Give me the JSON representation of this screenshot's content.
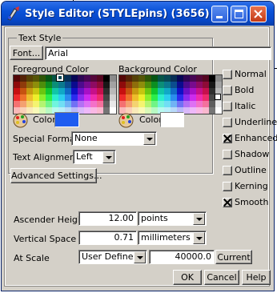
{
  "window": {
    "title": "Style Editor (STYLEpins) (3656)"
  },
  "text_style": {
    "group_label": "Text Style",
    "font_button": "Font...",
    "font_value": "Arial",
    "foreground_label": "Foreground Color",
    "background_label": "Background Color",
    "fg_color_label": "Color",
    "bg_color_label": "Color",
    "foreground_color": "#1e5cf0",
    "background_color": "#ffffff"
  },
  "special_format": {
    "label": "Special Format",
    "value": "None"
  },
  "text_alignment": {
    "label": "Text Alignment",
    "value": "Left"
  },
  "advanced_button": "Advanced Settings...",
  "styles": [
    {
      "label": "Normal",
      "checked": false
    },
    {
      "label": "Bold",
      "checked": false
    },
    {
      "label": "Italic",
      "checked": false
    },
    {
      "label": "Underline",
      "checked": false
    },
    {
      "label": "Enhanced",
      "checked": true
    },
    {
      "label": "Shadow",
      "checked": false
    },
    {
      "label": "Outline",
      "checked": false
    },
    {
      "label": "Kerning",
      "checked": false
    },
    {
      "label": "Smooth",
      "checked": true
    }
  ],
  "ascender": {
    "label": "Ascender Height",
    "value": "12.00",
    "unit": "points"
  },
  "vertical_space": {
    "label": "Vertical Space",
    "value": "0.71",
    "unit": "millimeters"
  },
  "at_scale": {
    "label": "At Scale",
    "mode": "User Defined",
    "value": "40000.0",
    "current_button": "Current"
  },
  "buttons": {
    "ok": "OK",
    "cancel": "Cancel",
    "help": "Help"
  }
}
